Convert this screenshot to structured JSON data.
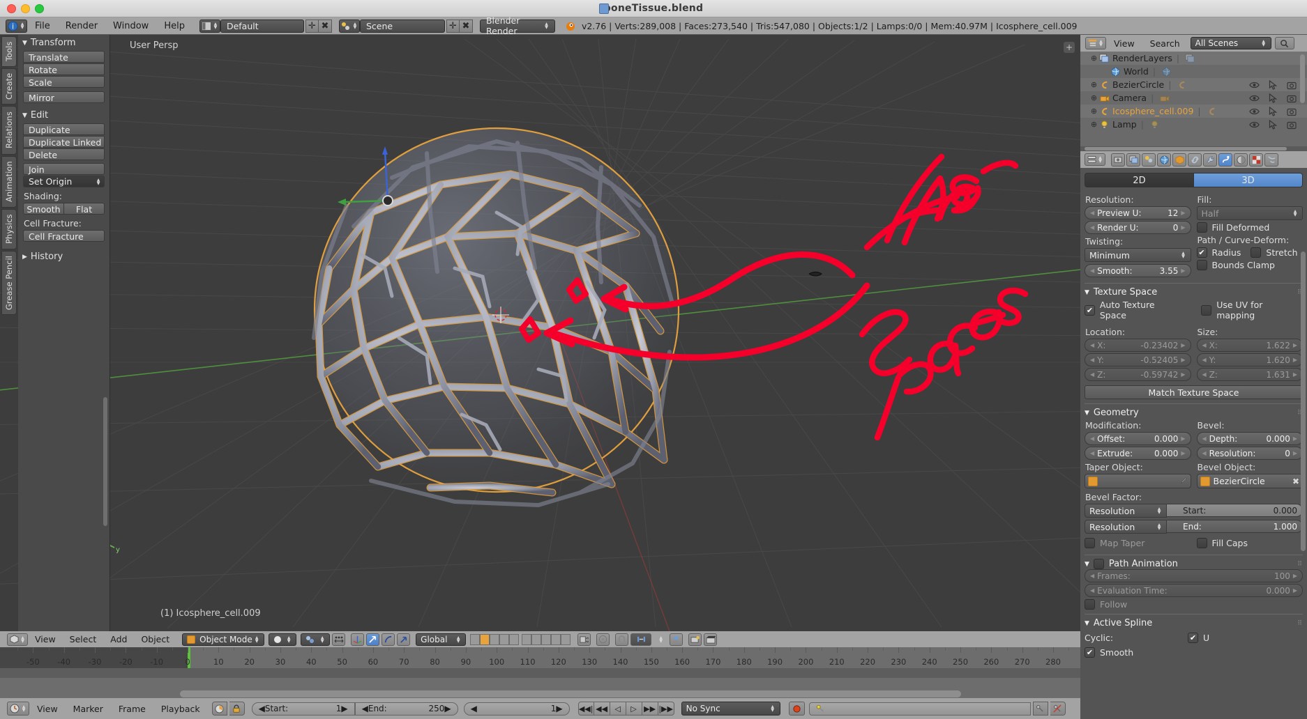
{
  "window": {
    "title": "boneTissue.blend",
    "traffic_lights": [
      "close",
      "minimize",
      "zoom"
    ]
  },
  "topbar": {
    "menus": [
      "File",
      "Render",
      "Window",
      "Help"
    ],
    "screen_layout": "Default",
    "scene": "Scene",
    "render_engine": "Blender Render",
    "info": "v2.76 | Verts:289,008 | Faces:273,540 | Tris:547,080 | Objects:1/2 | Lamps:0/0 | Mem:40.97M | Icosphere_cell.009"
  },
  "toolshelf": {
    "tabs": [
      "Tools",
      "Create",
      "Relations",
      "Animation",
      "Physics",
      "Grease Pencil"
    ],
    "active_tab": "Tools",
    "transform": {
      "title": "Transform",
      "buttons": [
        "Translate",
        "Rotate",
        "Scale",
        "Mirror"
      ]
    },
    "edit": {
      "title": "Edit",
      "buttons": [
        "Duplicate",
        "Duplicate Linked",
        "Delete",
        "Join",
        "Set Origin"
      ],
      "shading_label": "Shading:",
      "shading_buttons": [
        "Smooth",
        "Flat"
      ],
      "cell_fracture_label": "Cell Fracture:",
      "cell_fracture_button": "Cell Fracture"
    },
    "history": {
      "title": "History"
    }
  },
  "viewport": {
    "view_label": "User Persp",
    "object_label": "(1) Icosphere_cell.009",
    "annotations": [
      {
        "text": "These",
        "color": "#f5002b"
      },
      {
        "text": "Spaces",
        "color": "#f5002b"
      }
    ],
    "annotation_color": "#f5002b",
    "header": {
      "menus": [
        "View",
        "Select",
        "Add",
        "Object"
      ],
      "mode": "Object Mode",
      "transform_orientation": "Global"
    }
  },
  "timeline": {
    "ruler_ticks": [
      -50,
      -40,
      -30,
      -20,
      -10,
      0,
      10,
      20,
      30,
      40,
      50,
      60,
      70,
      80,
      90,
      100,
      110,
      120,
      130,
      140,
      150,
      160,
      170,
      180,
      190,
      200,
      210,
      220,
      230,
      240,
      250,
      260,
      270,
      280
    ],
    "current_frame_marker": 0
  },
  "playbar": {
    "menus": [
      "View",
      "Marker",
      "Frame",
      "Playback"
    ],
    "start_label": "Start:",
    "start_value": "1",
    "end_label": "End:",
    "end_value": "250",
    "current_frame": "1",
    "sync_mode": "No Sync",
    "transport": [
      "jump-start",
      "rewind",
      "play-reverse",
      "play",
      "fast-forward",
      "jump-end"
    ]
  },
  "outliner": {
    "header": {
      "view": "View",
      "search": "Search",
      "scope": "All Scenes"
    },
    "rows": [
      {
        "name": "RenderLayers",
        "icon": "renderlayers-icon",
        "indent": 1,
        "expandable": true,
        "selected": false,
        "has_toggles": false
      },
      {
        "name": "World",
        "icon": "world-icon",
        "indent": 2,
        "expandable": false,
        "selected": false,
        "has_toggles": false
      },
      {
        "name": "BezierCircle",
        "icon": "curve-icon",
        "indent": 1,
        "expandable": true,
        "selected": false,
        "has_toggles": true
      },
      {
        "name": "Camera",
        "icon": "camera-icon",
        "indent": 1,
        "expandable": true,
        "selected": false,
        "has_toggles": true
      },
      {
        "name": "Icosphere_cell.009",
        "icon": "curve-icon",
        "indent": 1,
        "expandable": true,
        "selected": true,
        "has_toggles": true
      },
      {
        "name": "Lamp",
        "icon": "lamp-icon",
        "indent": 1,
        "expandable": true,
        "selected": false,
        "has_toggles": true
      }
    ]
  },
  "properties": {
    "tabs": [
      "render-icon",
      "renderlayers-icon",
      "scene-icon",
      "world-icon",
      "object-icon",
      "constraints-icon",
      "modifiers-icon",
      "curve-data-icon",
      "material-icon",
      "texture-icon",
      "particles-icon"
    ],
    "active_tab_index": 7,
    "shape": {
      "mode_2d": "2D",
      "mode_3d": "3D",
      "active_mode": "3D",
      "resolution_label": "Resolution:",
      "preview_u_label": "Preview U:",
      "preview_u_value": "12",
      "render_u_label": "Render U:",
      "render_u_value": "0",
      "twisting_label": "Twisting:",
      "twisting_value": "Minimum",
      "smooth_label": "Smooth:",
      "smooth_value": "3.55",
      "fill_label": "Fill:",
      "fill_value": "Half",
      "fill_deformed": "Fill Deformed",
      "fill_deformed_checked": false,
      "path_curve_deform_label": "Path / Curve-Deform:",
      "radius_label": "Radius",
      "radius_checked": true,
      "stretch_label": "Stretch",
      "stretch_checked": false,
      "bounds_clamp_label": "Bounds Clamp",
      "bounds_clamp_checked": false
    },
    "texture_space": {
      "title": "Texture Space",
      "auto_texture_space": "Auto Texture Space",
      "auto_checked": true,
      "use_uv_for_mapping": "Use UV for mapping",
      "uv_checked": false,
      "location_label": "Location:",
      "location": {
        "x": "-0.23402",
        "y": "-0.52405",
        "z": "-0.59742"
      },
      "size_label": "Size:",
      "size": {
        "x": "1.622",
        "y": "1.620",
        "z": "1.631"
      },
      "match_button": "Match Texture Space",
      "axis_labels": [
        "X:",
        "Y:",
        "Z:"
      ]
    },
    "geometry": {
      "title": "Geometry",
      "modification_label": "Modification:",
      "offset_label": "Offset:",
      "offset_value": "0.000",
      "extrude_label": "Extrude:",
      "extrude_value": "0.000",
      "bevel_label": "Bevel:",
      "depth_label": "Depth:",
      "depth_value": "0.000",
      "resolution_label": "Resolution:",
      "resolution_value": "0",
      "taper_object_label": "Taper Object:",
      "taper_object_value": "",
      "bevel_object_label": "Bevel Object:",
      "bevel_object_value": "BezierCircle",
      "bevel_factor_label": "Bevel Factor:",
      "start_mode": "Resolution",
      "start_label": "Start:",
      "start_value": "0.000",
      "end_mode": "Resolution",
      "end_label": "End:",
      "end_value": "1.000",
      "map_taper": "Map Taper",
      "map_taper_checked": false,
      "fill_caps": "Fill Caps",
      "fill_caps_checked": false
    },
    "path_animation": {
      "title": "Path Animation",
      "enabled": false,
      "frames_label": "Frames:",
      "frames_value": "100",
      "evaluation_time_label": "Evaluation Time:",
      "evaluation_time_value": "0.000",
      "follow_label": "Follow",
      "follow_checked": false
    },
    "active_spline": {
      "title": "Active Spline",
      "cyclic_label": "Cyclic:",
      "cyclic_u": "U",
      "cyclic_checked": true,
      "smooth_label": "Smooth",
      "smooth_checked": true
    }
  }
}
